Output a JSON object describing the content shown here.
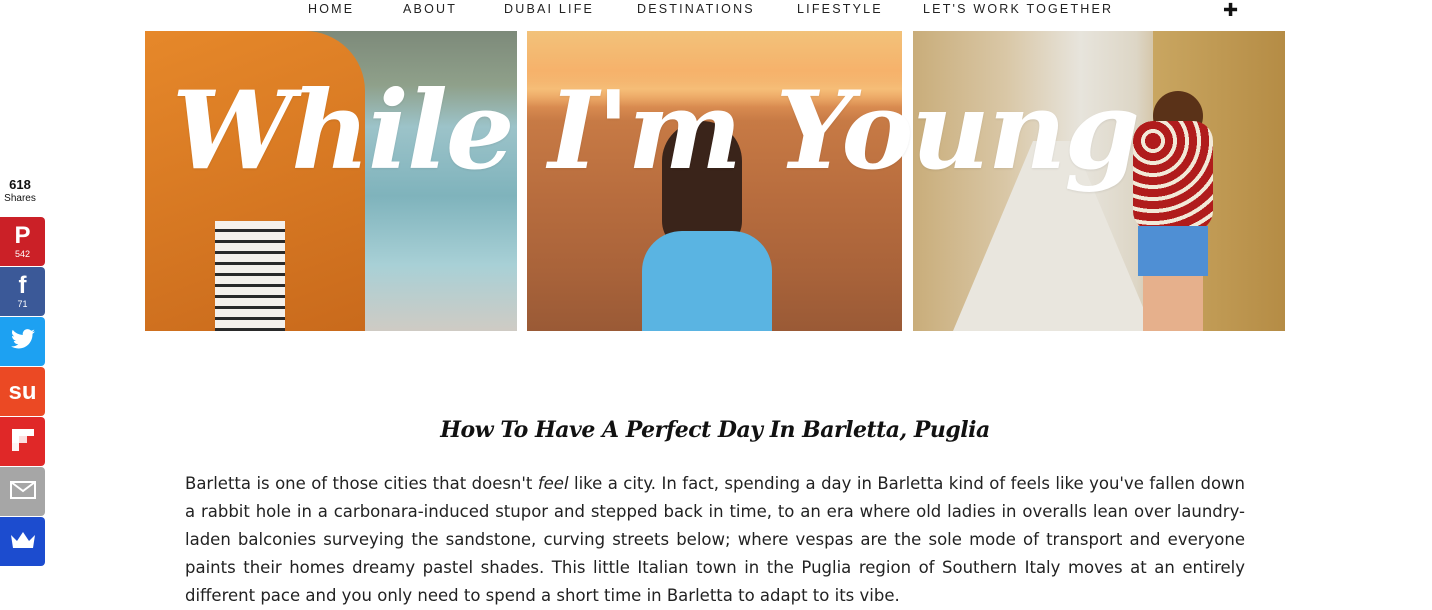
{
  "nav": {
    "items": [
      "HOME",
      "ABOUT",
      "DUBAI LIFE",
      "DESTINATIONS",
      "LIFESTYLE",
      "LET'S WORK TOGETHER"
    ],
    "more_icon": "plus-icon",
    "more_glyph": "✚"
  },
  "header": {
    "blog_title": "While I'm Young"
  },
  "share": {
    "total": "618",
    "total_label": "Shares",
    "buttons": [
      {
        "network": "pinterest",
        "icon": "pinterest-icon",
        "glyph": "P",
        "count": "542",
        "color": "#cb2027"
      },
      {
        "network": "facebook",
        "icon": "facebook-icon",
        "glyph": "f",
        "count": "71",
        "color": "#3b5998"
      },
      {
        "network": "twitter",
        "icon": "twitter-icon",
        "glyph": "🐦",
        "count": "",
        "color": "#1da1f2"
      },
      {
        "network": "stumbleupon",
        "icon": "stumbleupon-icon",
        "glyph": "su",
        "count": "",
        "color": "#eb4924"
      },
      {
        "network": "flipboard",
        "icon": "flipboard-icon",
        "glyph": "▞",
        "count": "",
        "color": "#e02828"
      },
      {
        "network": "email",
        "icon": "email-icon",
        "glyph": "✉",
        "count": "",
        "color": "#a6a6a6"
      },
      {
        "network": "sumome",
        "icon": "crown-icon",
        "glyph": "♛",
        "count": "",
        "color": "#1c4ccf"
      }
    ]
  },
  "post": {
    "title": "How To Have A Perfect Day In Barletta, Puglia",
    "body_before": "Barletta is one of those cities that doesn't ",
    "body_em": "feel",
    "body_after": " like a city. In fact, spending a day in Barletta kind of feels like you've fallen down a rabbit hole in a carbonara-induced stupor and stepped back in time, to an era where old ladies in overalls lean over laundry-laden balconies surveying the sandstone, curving streets below; where vespas are the sole mode of transport and everyone paints their homes dreamy pastel shades. This little Italian town in the Puglia region of Southern Italy moves at an entirely different pace and you only need to spend a short time in Barletta to adapt to its vibe."
  }
}
